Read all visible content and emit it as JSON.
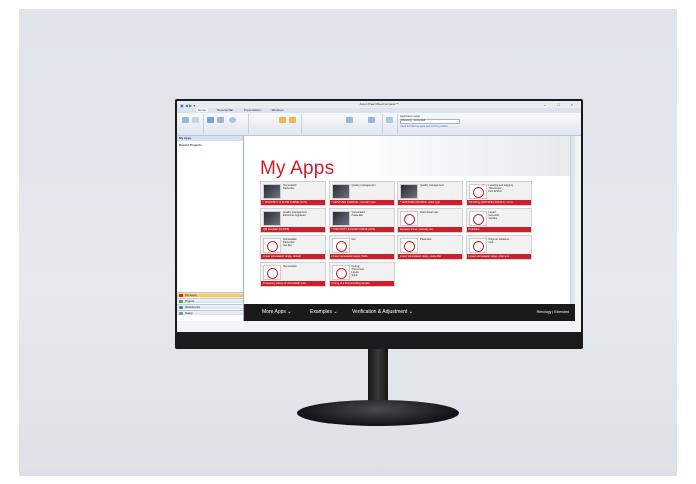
{
  "app": {
    "title": "Anton Paar RheoCompass™",
    "tabs": [
      "Home",
      "Reports/Tab",
      "Presentation",
      "Windows"
    ],
    "window_controls": "– □ ×"
  },
  "ribbon": {
    "app_mode_label": "Application mode",
    "app_mode_value": "Rheology - Extended",
    "filter_hint": "Used for filtering apps and sorting profiles"
  },
  "sidebar": {
    "header": "My Apps",
    "recent": "Recent Projects",
    "nav": [
      "My Apps",
      "Project",
      "Workbooks",
      "Setup"
    ]
  },
  "main": {
    "title": "My Apps",
    "tiles": [
      {
        "desc": "Viscoelastic\nPaste-like",
        "bar": "* VISCOSITY & FLOW CURVE (VCS)",
        "thumb": "dark"
      },
      {
        "desc": "Quality management",
        "bar": "* LEISTUNG CHARGE...cemistry type",
        "thumb": "dark"
      },
      {
        "desc": "Quality management",
        "bar": "* LEISTUNG CHARGE...plate type",
        "thumb": "dark"
      },
      {
        "desc": "Leveling and sagging\nThixotropic\nISO 3219-6",
        "bar": "Thixotropy (DIN SPEC 91143-1), no st...",
        "thumb": "red"
      },
      {
        "desc": "Quality management\nElectronic signature",
        "bar": "QM template (CFOPS)",
        "thumb": "dark"
      },
      {
        "desc": "Viscoelastic\nPaste-like",
        "bar": "* VISCOSITY & FLOW CURVE (VCS)",
        "thumb": "dark"
      },
      {
        "desc": "Fluid shear rate",
        "bar": "Dynamic shear, viscosity test",
        "thumb": "red"
      },
      {
        "desc": "Liquid\nGel-solid\nGel-like",
        "bar": "Definition",
        "thumb": "red"
      },
      {
        "desc": "Viscoelastic\nPaste-like\nGel-like",
        "bar": "Linear viscoelastic range, default",
        "thumb": "red"
      },
      {
        "desc": "Gel",
        "bar": "Linear viscoelastic range, fluids",
        "thumb": "red"
      },
      {
        "desc": "Paste-like",
        "bar": "Linear viscoelastic range, paste-like",
        "thumb": "red"
      },
      {
        "desc": "Polymer solutions\nmelt",
        "bar": "Linear viscoelastic range, polymers",
        "thumb": "red"
      },
      {
        "desc": "Viscoelastic",
        "bar": "Frequency sweep of viscoelastic sam...",
        "thumb": "red"
      },
      {
        "desc": "Curing\nThermoset\nLiquid\nSolid",
        "bar": "Curing of a thermosetting sample",
        "thumb": "red"
      }
    ]
  },
  "bottombar": {
    "links": [
      "More Apps",
      "Examples",
      "Verification & Adjustment"
    ],
    "mode": "Rheology | Extended"
  },
  "colors": {
    "accent_red": "#cc1f2b",
    "active_nav": "#f5b942",
    "bottom_bar": "#1a1a1a"
  }
}
